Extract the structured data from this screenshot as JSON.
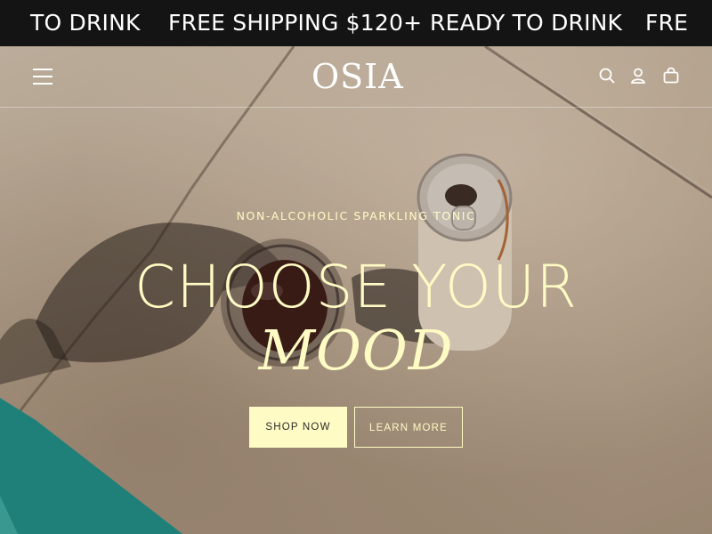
{
  "announcement": {
    "messages": [
      "TO DRINK",
      "FREE SHIPPING $120+",
      "READY TO DRINK",
      "FRE"
    ]
  },
  "header": {
    "logo": "OSIA",
    "icons": [
      "hamburger-menu-icon",
      "search-icon",
      "account-icon",
      "cart-icon"
    ]
  },
  "hero": {
    "eyebrow": "NON-ALCOHOLIC SPARKLING TONIC",
    "headline": "CHOOSE YOUR",
    "headline_accent": "MOOD",
    "primary_cta": "SHOP NOW",
    "secondary_cta": "LEARN MORE"
  },
  "colors": {
    "announcement_bg": "#141414",
    "accent_cream": "#fffbc4",
    "header_text": "#ffffff"
  }
}
